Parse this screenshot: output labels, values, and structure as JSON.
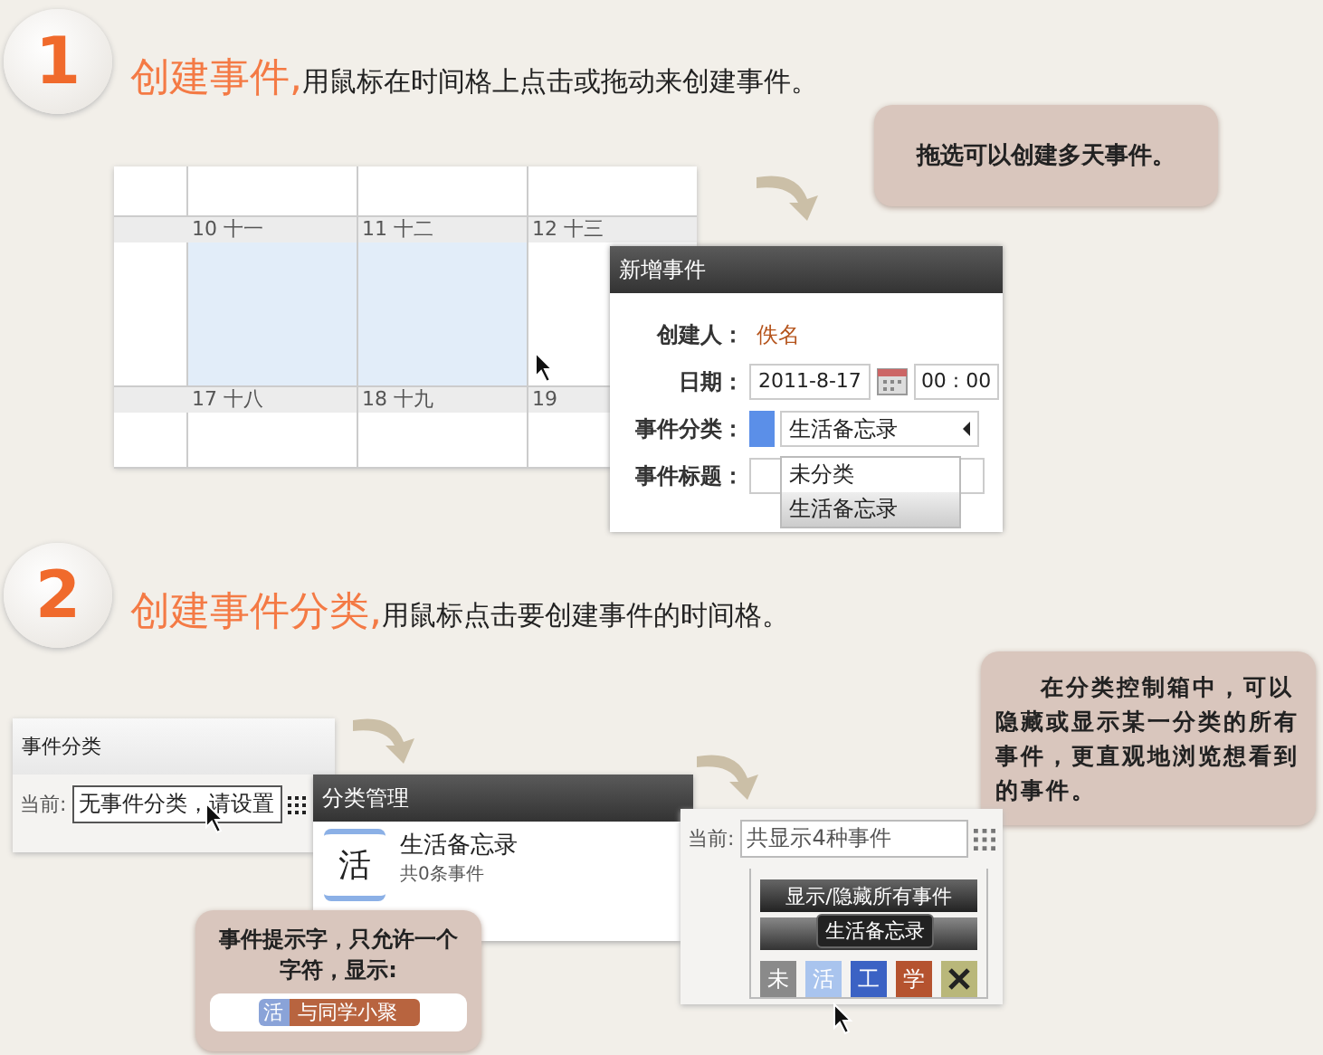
{
  "step1": {
    "number": "1",
    "title": "创建事件,",
    "text": "用鼠标在时间格上点击或拖动来创建事件。",
    "callout": "拖选可以创建多天事件。"
  },
  "calendar": {
    "rows": [
      {
        "days": [
          {
            "label": "10 十一",
            "selected": true
          },
          {
            "label": "11 十二",
            "selected": true
          },
          {
            "label": "12 十三",
            "selected": false
          }
        ]
      },
      {
        "days": [
          {
            "label": "17 十八",
            "selected": false
          },
          {
            "label": "18 十九",
            "selected": false
          },
          {
            "label": "19",
            "selected": false
          }
        ]
      }
    ]
  },
  "new_event_dialog": {
    "title": "新增事件",
    "creator_label": "创建人：",
    "creator": "佚名",
    "date_label": "日期：",
    "date": "2011-8-17",
    "time": "00 : 00",
    "category_label": "事件分类：",
    "category": "生活备忘录",
    "title_label": "事件标题：",
    "options": [
      {
        "label": "未分类",
        "selected": false
      },
      {
        "label": "生活备忘录",
        "selected": true
      }
    ]
  },
  "step2": {
    "number": "2",
    "title": "创建事件分类,",
    "text": "用鼠标点击要创建事件的时间格。",
    "callout": "在分类控制箱中，可以隐藏或显示某一分类的所有事件，更直观地浏览想看到的事件。"
  },
  "category_panel": {
    "title": "事件分类",
    "current_label": "当前:",
    "value": "无事件分类，请设置"
  },
  "category_manager": {
    "title": "分类管理",
    "items": [
      {
        "char": "活",
        "name": "生活备忘录",
        "count": "共0条事件"
      }
    ]
  },
  "hint_callout": {
    "text": "事件提示字，只允许一个字符，显示:",
    "tag_char": "活",
    "tag_text": "与同学小聚"
  },
  "filter_panel": {
    "current_label": "当前:",
    "value": "共显示4种事件",
    "toggle_all": "显示/隐藏所有事件",
    "tooltip": "生活备忘录",
    "categories": [
      {
        "kind": "char",
        "char": "未",
        "color": "#8a8a8a"
      },
      {
        "kind": "char",
        "char": "活",
        "color": "#a9c4ee"
      },
      {
        "kind": "char",
        "char": "工",
        "color": "#3b62c4"
      },
      {
        "kind": "char",
        "char": "学",
        "color": "#b5532f"
      },
      {
        "kind": "delete",
        "color": "#b9b77a"
      }
    ]
  }
}
